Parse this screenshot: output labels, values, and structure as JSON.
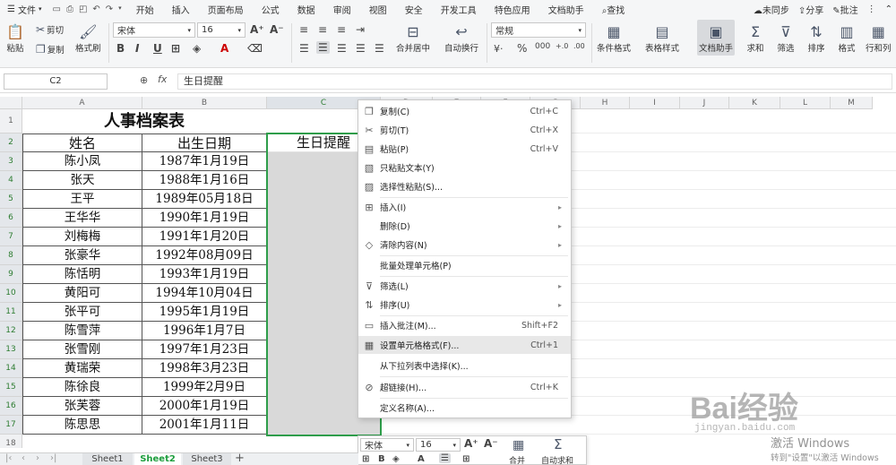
{
  "menubar": {
    "file_label": "文件",
    "tabs": [
      "开始",
      "插入",
      "页面布局",
      "公式",
      "数据",
      "审阅",
      "视图",
      "安全",
      "开发工具",
      "特色应用",
      "文档助手"
    ],
    "active_tab": "开始",
    "search_label": "查找",
    "sync_label": "未同步",
    "share_label": "分享",
    "comment_label": "批注"
  },
  "ribbon": {
    "paste_label": "粘贴",
    "cut_label": "剪切",
    "copy_label": "复制",
    "format_painter_label": "格式刷",
    "font_name": "宋体",
    "font_size": "16",
    "merge_label": "合并居中",
    "wrap_label": "自动换行",
    "number_format": "常规",
    "conditional_label": "条件格式",
    "table_style_label": "表格样式",
    "doc_assistant_label": "文档助手",
    "sum_label": "求和",
    "filter_label": "筛选",
    "sort_label": "排序",
    "format_label": "格式",
    "rowcol_label": "行和列"
  },
  "formula_bar": {
    "cell_ref": "C2",
    "fx": "fx",
    "content": "生日提醒"
  },
  "sheet": {
    "columns": [
      "A",
      "B",
      "C",
      "D",
      "E",
      "F",
      "G",
      "H",
      "I",
      "J",
      "K",
      "L",
      "M"
    ],
    "title": "人事档案表",
    "headers": [
      "姓名",
      "出生日期",
      "生日提醒"
    ],
    "rows": [
      [
        "陈小凤",
        "1987年1月19日"
      ],
      [
        "张天",
        "1988年1月16日"
      ],
      [
        "王平",
        "1989年05月18日"
      ],
      [
        "王华华",
        "1990年1月19日"
      ],
      [
        "刘梅梅",
        "1991年1月20日"
      ],
      [
        "张豪华",
        "1992年08月09日"
      ],
      [
        "陈恬明",
        "1993年1月19日"
      ],
      [
        "黄阳可",
        "1994年10月04日"
      ],
      [
        "张平可",
        "1995年1月19日"
      ],
      [
        "陈雪萍",
        "1996年1月7日"
      ],
      [
        "张雪刚",
        "1997年1月23日"
      ],
      [
        "黄瑞荣",
        "1998年3月23日"
      ],
      [
        "陈徐良",
        "1999年2月9日"
      ],
      [
        "张芙蓉",
        "2000年1月19日"
      ],
      [
        "陈思思",
        "2001年1月11日"
      ]
    ],
    "row_numbers": [
      "1",
      "2",
      "3",
      "4",
      "5",
      "6",
      "7",
      "8",
      "9",
      "10",
      "11",
      "12",
      "13",
      "14",
      "15",
      "16",
      "17",
      "18"
    ]
  },
  "context_menu": {
    "items": [
      {
        "icon": "copy-icon",
        "label": "复制(C)",
        "shortcut": "Ctrl+C"
      },
      {
        "icon": "cut-icon",
        "label": "剪切(T)",
        "shortcut": "Ctrl+X"
      },
      {
        "icon": "paste-icon",
        "label": "粘贴(P)",
        "shortcut": "Ctrl+V"
      },
      {
        "icon": "paste-text-icon",
        "label": "只粘贴文本(Y)",
        "shortcut": ""
      },
      {
        "icon": "paste-special-icon",
        "label": "选择性粘贴(S)...",
        "shortcut": ""
      },
      {
        "icon": "insert-icon",
        "label": "插入(I)",
        "shortcut": ""
      },
      {
        "icon": "delete-icon",
        "label": "删除(D)",
        "shortcut": ""
      },
      {
        "icon": "clear-icon",
        "label": "清除内容(N)",
        "shortcut": ""
      },
      {
        "icon": "",
        "label": "批量处理单元格(P)",
        "shortcut": ""
      },
      {
        "icon": "filter-icon",
        "label": "筛选(L)",
        "shortcut": ""
      },
      {
        "icon": "sort-icon",
        "label": "排序(U)",
        "shortcut": ""
      },
      {
        "icon": "comment-icon",
        "label": "插入批注(M)...",
        "shortcut": "Shift+F2"
      },
      {
        "icon": "format-cells-icon",
        "label": "设置单元格格式(F)...",
        "shortcut": "Ctrl+1"
      },
      {
        "icon": "",
        "label": "从下拉列表中选择(K)...",
        "shortcut": ""
      },
      {
        "icon": "link-icon",
        "label": "超链接(H)...",
        "shortcut": "Ctrl+K"
      },
      {
        "icon": "",
        "label": "定义名称(A)...",
        "shortcut": ""
      }
    ]
  },
  "mini_toolbar": {
    "font_name": "宋体",
    "font_size": "16",
    "merge_label": "合并",
    "autosum_label": "自动求和"
  },
  "sheet_tabs": {
    "tabs": [
      "Sheet1",
      "Sheet2",
      "Sheet3"
    ],
    "active": "Sheet2",
    "add": "+"
  },
  "watermark": {
    "brand": "Bai经验",
    "url": "jingyan.baidu.com",
    "activate_title": "激活 Windows",
    "activate_sub": "转到\"设置\"以激活 Windows"
  }
}
